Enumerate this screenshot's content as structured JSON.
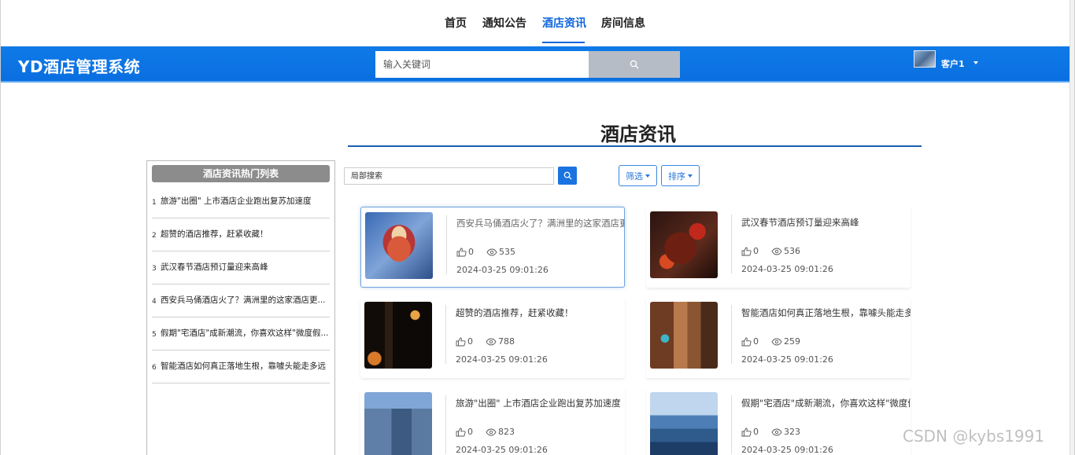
{
  "nav": {
    "items": [
      {
        "label": "首页"
      },
      {
        "label": "通知公告"
      },
      {
        "label": "酒店资讯"
      },
      {
        "label": "房间信息"
      }
    ],
    "active": "酒店资讯"
  },
  "header": {
    "logo": "YD酒店管理系统",
    "search_placeholder": "输入关键词",
    "user_name": "客户1"
  },
  "main": {
    "title": "酒店资讯",
    "local_search_placeholder": "局部搜索",
    "filter_label": "筛选",
    "sort_label": "排序"
  },
  "sidebar": {
    "title": "酒店资讯热门列表",
    "items": [
      {
        "num": "1",
        "text": "旅游\"出圈\" 上市酒店企业跑出复苏加速度"
      },
      {
        "num": "2",
        "text": "超赞的酒店推荐，赶紧收藏！"
      },
      {
        "num": "3",
        "text": "武汉春节酒店预订量迎来高峰"
      },
      {
        "num": "4",
        "text": "西安兵马俑酒店火了？满洲里的这家酒店更..."
      },
      {
        "num": "5",
        "text": "假期\"宅酒店\"成新潮流，你喜欢这样\"微度假..."
      },
      {
        "num": "6",
        "text": "智能酒店如何真正落地生根，靠噱头能走多远"
      }
    ]
  },
  "articles": [
    {
      "title": "西安兵马俑酒店火了？满洲里的这家酒店更",
      "likes": "0",
      "views": "535",
      "date": "2024-03-25 09:01:26",
      "thumb": "doll"
    },
    {
      "title": "武汉春节酒店预订量迎来高峰",
      "likes": "0",
      "views": "536",
      "date": "2024-03-25 09:01:26",
      "thumb": "meat"
    },
    {
      "title": "超赞的酒店推荐，赶紧收藏！",
      "likes": "0",
      "views": "788",
      "date": "2024-03-25 09:01:26",
      "thumb": "sign"
    },
    {
      "title": "智能酒店如何真正落地生根，靠噱头能走多",
      "likes": "0",
      "views": "259",
      "date": "2024-03-25 09:01:26",
      "thumb": "corridor"
    },
    {
      "title": "旅游\"出圈\" 上市酒店企业跑出复苏加速度",
      "likes": "0",
      "views": "823",
      "date": "2024-03-25 09:01:26",
      "thumb": "building"
    },
    {
      "title": "假期\"宅酒店\"成新潮流，你喜欢这样\"微度假",
      "likes": "0",
      "views": "323",
      "date": "2024-03-25 09:01:26",
      "thumb": "resort"
    }
  ],
  "watermark": "CSDN @kybs1991",
  "colors": {
    "accent": "#1166dd",
    "header_bg": "#0f7ae8",
    "sidebar_title_bg": "#8c8c8c"
  }
}
